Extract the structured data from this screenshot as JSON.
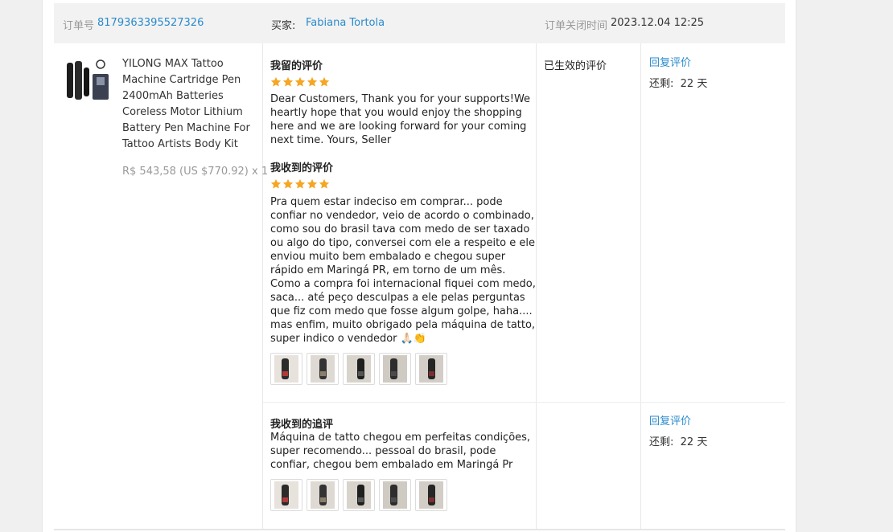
{
  "order": {
    "number_label": "订单号",
    "number": "8179363395527326",
    "buyer_label": "买家:",
    "buyer_name": "Fabiana Tortola",
    "close_label": "订单关闭时间",
    "close_time": "2023.12.04 12:25"
  },
  "product": {
    "title": "YILONG MAX Tattoo Machine Cartridge Pen 2400mAh Batteries Coreless Motor Lithium Battery Pen Machine For Tattoo Artists Body Kit",
    "price": "R$ 543,58 (US $770.92) x 1"
  },
  "my_review": {
    "label": "我留的评价",
    "rating": 5,
    "text": "Dear Customers, Thank you for your supports!We heartly hope that you would enjoy the shopping here and we are looking forward for your coming next time. Yours, Seller"
  },
  "received_review": {
    "label": "我收到的评价",
    "rating": 5,
    "text": "Pra quem estar indeciso em comprar... pode confiar no vendedor, veio de acordo o combinado, como sou do brasil tava com medo de ser taxado ou algo do tipo, conversei com ele a respeito e ele enviou muito bem embalado e chegou super rápido em Maringá PR, em torno de um mês. Como a compra foi internacional fiquei com medo, saca... até peço desculpas a ele pelas perguntas que fiz com medo que fosse algum golpe, haha.... mas enfim, muito obrigado pela máquina de tatto, super indico o vendedor 🙏🏻👏",
    "photo_count": 5
  },
  "followup_review": {
    "label": "我收到的追评",
    "text": "Máquina de tatto chegou em perfeitas condições, super recomendo... pessoal do brasil, pode confiar, chegou bem embalado em Maringá Pr",
    "photo_count": 5
  },
  "status_text": "已生效的评价",
  "actions": [
    {
      "reply_label": "回复评价",
      "remaining_label": "还剩:",
      "remaining_value": "22 天"
    },
    {
      "reply_label": "回复评价",
      "remaining_label": "还剩:",
      "remaining_value": "22 天"
    }
  ],
  "colors": {
    "link": "#2a8bcc",
    "star": "#f5a623",
    "header_bg": "#f2f2f2"
  },
  "icons": [
    "product-thumbnail-image",
    "star-icon",
    "review-photo-thumbnail"
  ]
}
